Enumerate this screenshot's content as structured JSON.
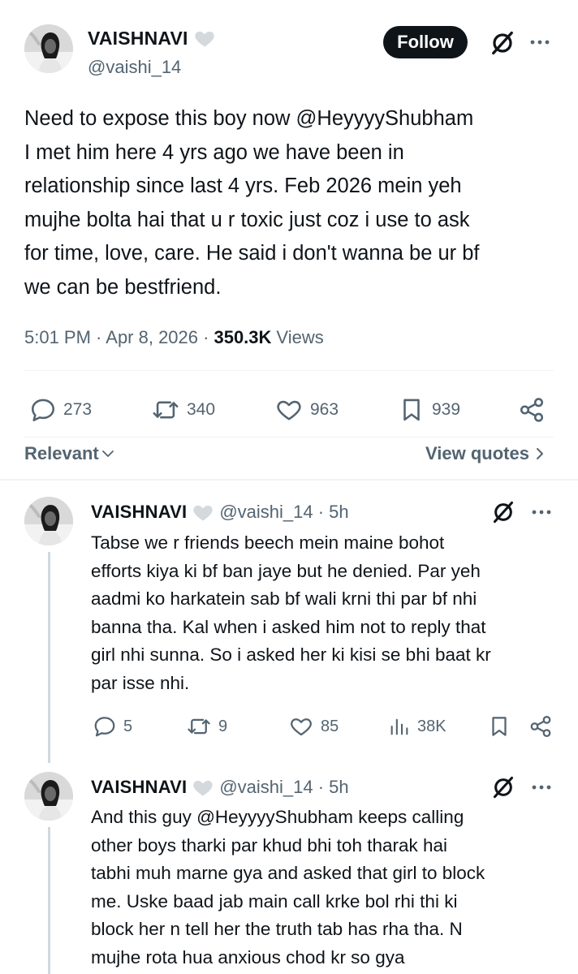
{
  "main_tweet": {
    "display_name": "VAISHNAVI",
    "handle": "@vaishi_14",
    "follow_label": "Follow",
    "text_lines": [
      "Need to expose this boy now @HeyyyyShubham",
      "I met him here 4 yrs ago we have been in",
      "relationship since last 4 yrs. Feb 2026 mein yeh",
      "mujhe bolta hai that u r toxic just coz i use to ask",
      "for time, love, care. He said i don't wanna be ur bf",
      "we can be bestfriend."
    ],
    "time": "5:01 PM · Apr 8, 2026 ·",
    "views_count": "350.3K",
    "views_label": "Views",
    "replies": "273",
    "reposts": "340",
    "likes": "963",
    "bookmarks": "939"
  },
  "sort": {
    "relevant_label": "Relevant",
    "view_quotes_label": "View quotes"
  },
  "replies": [
    {
      "display_name": "VAISHNAVI",
      "handle_time": "@vaishi_14 · 5h",
      "text_lines": [
        "Tabse we r friends beech mein maine bohot",
        "efforts kiya ki bf ban jaye but he denied. Par yeh",
        "aadmi ko harkatein sab bf wali krni thi par bf nhi",
        "banna tha. Kal when i asked him not to reply that",
        "girl nhi sunna. So i asked her ki kisi se bhi baat kr",
        "par isse nhi."
      ],
      "replies": "5",
      "reposts": "9",
      "likes": "85",
      "views": "38K"
    },
    {
      "display_name": "VAISHNAVI",
      "handle_time": "@vaishi_14 · 5h",
      "text_lines": [
        "And this guy @HeyyyyShubham keeps calling",
        "other boys tharki par khud bhi toh tharak hai",
        "tabhi muh marne gya and asked that girl to block",
        "me. Uske baad jab main call krke bol rhi thi ki",
        "block her n tell her the truth tab has rha tha. N",
        "mujhe rota hua anxious chod kr so gya"
      ]
    }
  ],
  "icons": {
    "verified": "heart-badge-icon",
    "grok": "grok-icon",
    "more": "more-icon",
    "reply": "reply-icon",
    "repost": "repost-icon",
    "like": "like-icon",
    "bookmark": "bookmark-icon",
    "share": "share-icon",
    "views": "views-icon"
  }
}
